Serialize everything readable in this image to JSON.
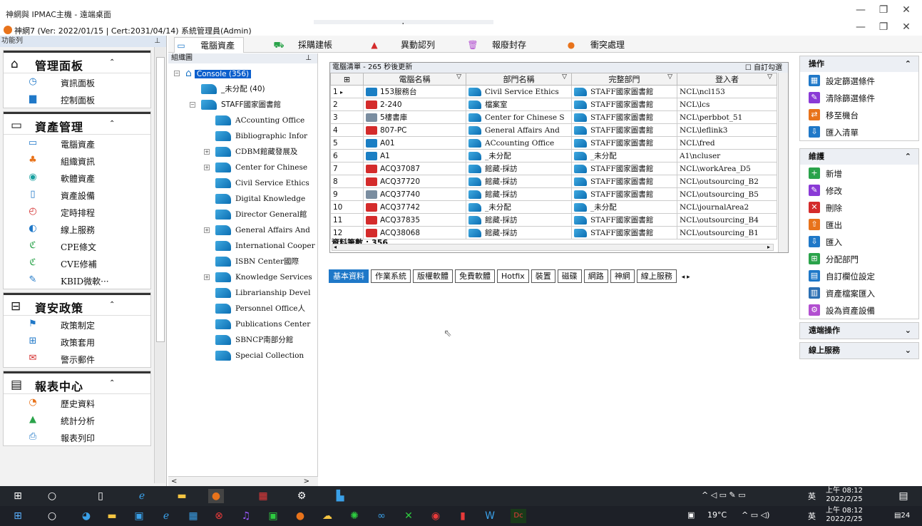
{
  "remote": {
    "title": "神網與 IPMAC主機 - 遠端桌面",
    "zoom_bar": "⊕ | ···"
  },
  "app": {
    "title": "神網7 (Ver: 2022/01/15 | Cert:2031/04/14)  系統管理員(Admin)"
  },
  "left": {
    "header": "功能列",
    "groups": [
      {
        "title": "管理面板",
        "items": [
          "資訊面板",
          "控制面板"
        ]
      },
      {
        "title": "資產管理",
        "items": [
          "電腦資產",
          "組織資訊",
          "軟體資產",
          "資產設備",
          "定時排程",
          "線上服務",
          "CPE條文",
          "CVE修補",
          "KBID微軟···"
        ]
      },
      {
        "title": "資安政策",
        "items": [
          "政策制定",
          "政策套用",
          "警示郵件"
        ]
      },
      {
        "title": "報表中心",
        "items": [
          "歷史資料",
          "統計分析",
          "報表列印"
        ]
      }
    ]
  },
  "tabs": [
    "電腦資產",
    "採購建帳",
    "異動認列",
    "報廢封存",
    "衝突處理"
  ],
  "tree": {
    "header": "組織圖",
    "root": "Console (356)",
    "unassigned": "_未分配 (40)",
    "library": "STAFF國家圖書館",
    "children": [
      "ACcounting Office",
      "Bibliographic Infor",
      "CDBM館藏發展及",
      "Center for Chinese",
      "Civil Service Ethics",
      "Digital Knowledge",
      "Director General館",
      "General Affairs And",
      "International Cooper",
      "ISBN Center國際",
      "Knowledge Services",
      "Librarianship Devel",
      "Personnel Office人",
      "Publications Center",
      "SBNCP南部分館",
      "Special Collection"
    ]
  },
  "grid": {
    "caption": "電腦清單 - 265 秒後更新",
    "custom_check": "自訂勾選",
    "columns": [
      "",
      "電腦名稱",
      "部門名稱",
      "完整部門",
      "登入者"
    ],
    "rows": [
      {
        "n": "1",
        "name": "153服務台",
        "dept": "Civil Service Ethics",
        "full": "STAFF國家圖書館",
        "user": "NCL\\ncl153",
        "icon": "blue"
      },
      {
        "n": "2",
        "name": "2-240",
        "dept": "檔案室",
        "full": "STAFF國家圖書館",
        "user": "NCL\\lcs",
        "icon": "red"
      },
      {
        "n": "3",
        "name": "5樓書庫",
        "dept": "Center for Chinese S",
        "full": "STAFF國家圖書館",
        "user": "NCL\\perbbot_51",
        "icon": "grey"
      },
      {
        "n": "4",
        "name": "807-PC",
        "dept": "General Affairs And",
        "full": "STAFF國家圖書館",
        "user": "NCL\\leflink3",
        "icon": "red"
      },
      {
        "n": "5",
        "name": "A01",
        "dept": "ACcounting Office",
        "full": "STAFF國家圖書館",
        "user": "NCL\\fred",
        "icon": "blue"
      },
      {
        "n": "6",
        "name": "A1",
        "dept": "_未分配",
        "full": "_未分配",
        "user": "A1\\ncluser",
        "icon": "blue"
      },
      {
        "n": "7",
        "name": "ACQ37087",
        "dept": "館藏-採訪",
        "full": "STAFF國家圖書館",
        "user": "NCL\\workArea_D5",
        "icon": "red"
      },
      {
        "n": "8",
        "name": "ACQ37720",
        "dept": "館藏-採訪",
        "full": "STAFF國家圖書館",
        "user": "NCL\\outsourcing_B2",
        "icon": "red"
      },
      {
        "n": "9",
        "name": "ACQ37740",
        "dept": "館藏-採訪",
        "full": "STAFF國家圖書館",
        "user": "NCL\\outsourcing_B5",
        "icon": "grey"
      },
      {
        "n": "10",
        "name": "ACQ37742",
        "dept": "_未分配",
        "full": "_未分配",
        "user": "NCL\\journalArea2",
        "icon": "red"
      },
      {
        "n": "11",
        "name": "ACQ37835",
        "dept": "館藏-採訪",
        "full": "STAFF國家圖書館",
        "user": "NCL\\outsourcing_B4",
        "icon": "red"
      },
      {
        "n": "12",
        "name": "ACQ38068",
        "dept": "館藏-採訪",
        "full": "STAFF國家圖書館",
        "user": "NCL\\outsourcing_B1",
        "icon": "red"
      }
    ],
    "total": "資料筆數 : 356"
  },
  "subtabs": [
    "基本資料",
    "作業系統",
    "版權軟體",
    "免費軟體",
    "Hotfix",
    "裝置",
    "磁碟",
    "網路",
    "神網",
    "線上服務"
  ],
  "right": {
    "sections": [
      {
        "title": "操作",
        "items": [
          {
            "label": "設定篩選條件",
            "color": "#1f78c8",
            "glyph": "▦"
          },
          {
            "label": "清除篩選條件",
            "color": "#8a3ad6",
            "glyph": "✎"
          },
          {
            "label": "移至機台",
            "color": "#e8731b",
            "glyph": "⇄"
          },
          {
            "label": "匯入清單",
            "color": "#1f78c8",
            "glyph": "⇩"
          }
        ]
      },
      {
        "title": "維護",
        "items": [
          {
            "label": "新增",
            "color": "#2aa34a",
            "glyph": "+"
          },
          {
            "label": "修改",
            "color": "#8a3ad6",
            "glyph": "✎"
          },
          {
            "label": "刪除",
            "color": "#d42b2b",
            "glyph": "✕"
          },
          {
            "label": "匯出",
            "color": "#e8731b",
            "glyph": "⇧"
          },
          {
            "label": "匯入",
            "color": "#1f78c8",
            "glyph": "⇩"
          },
          {
            "label": "分配部門",
            "color": "#2aa34a",
            "glyph": "⊞"
          },
          {
            "label": "自訂欄位設定",
            "color": "#1f78c8",
            "glyph": "▤"
          },
          {
            "label": "資產檔案匯入",
            "color": "#2b6fb3",
            "glyph": "▥"
          },
          {
            "label": "設為資產設備",
            "color": "#b24fd0",
            "glyph": "⚙"
          }
        ]
      },
      {
        "title": "遠端操作",
        "items": []
      },
      {
        "title": "線上服務",
        "items": []
      }
    ]
  },
  "taskbar1": {
    "ime": "英",
    "time": "上午 08:12",
    "date": "2022/2/25"
  },
  "taskbar2": {
    "weather": "19°C",
    "ime": "英",
    "time": "上午 08:12",
    "date": "2022/2/25",
    "notif": "24"
  }
}
